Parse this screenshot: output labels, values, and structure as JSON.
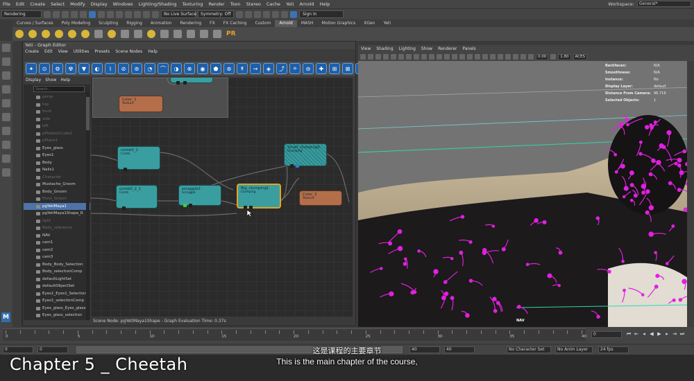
{
  "menubar": {
    "items": [
      "File",
      "Edit",
      "Create",
      "Select",
      "Modify",
      "Display",
      "Windows",
      "Lighting/Shading",
      "Texturing",
      "Render",
      "Toon",
      "Stereo",
      "Cache",
      "Yeti",
      "Arnold",
      "Help"
    ],
    "workspace_label": "Workspace:",
    "workspace_value": "General*"
  },
  "statusline": {
    "menuset": "Rendering",
    "live_surface": "No Live Surface",
    "symmetry": "Symmetry: Off",
    "sign_in": "Sign In"
  },
  "shelf": {
    "tabs": [
      "Curves / Surfaces",
      "Poly Modeling",
      "Sculpting",
      "Rigging",
      "Animation",
      "Rendering",
      "FX",
      "FX Caching",
      "Custom",
      "Arnold",
      "MASH",
      "Motion Graphics",
      "XGen",
      "Yeti"
    ],
    "active_tab": "Arnold"
  },
  "graph_editor": {
    "title": "Yeti - Graph Editor",
    "menu": [
      "Create",
      "Edit",
      "View",
      "Utilities",
      "Presets",
      "Scene Nodes",
      "Help"
    ],
    "status": "Scene Node: pgYetiMaya1Shape - Graph Evaluation Time: 0.37s"
  },
  "outliner": {
    "menu": [
      "Display",
      "Show",
      "Help"
    ],
    "search_placeholder": "Search...",
    "items": [
      {
        "label": "persp",
        "dim": true
      },
      {
        "label": "top",
        "dim": true
      },
      {
        "label": "front",
        "dim": true
      },
      {
        "label": "side",
        "dim": true
      },
      {
        "label": "left",
        "dim": true
      },
      {
        "label": "pPlatonicCube1",
        "dim": true
      },
      {
        "label": "pPlane1",
        "dim": true
      },
      {
        "label": "Eyes_glass",
        "dim": false
      },
      {
        "label": "Eyes1",
        "dim": false
      },
      {
        "label": "Body",
        "dim": false
      },
      {
        "label": "Nails1",
        "dim": false
      },
      {
        "label": "Character",
        "dim": true
      },
      {
        "label": "Mustache_Groom",
        "dim": false
      },
      {
        "label": "Body_Groom",
        "dim": false
      },
      {
        "label": "Front_Groom",
        "dim": true
      },
      {
        "label": "pgYetiMaya1",
        "dim": false,
        "selected": true
      },
      {
        "label": "pgYetiMaya1Shape_R",
        "dim": false
      },
      {
        "label": "light",
        "dim": true
      },
      {
        "label": "Body_reference",
        "dim": true
      },
      {
        "label": "NAV",
        "dim": false
      },
      {
        "label": "cam1",
        "dim": false
      },
      {
        "label": "cam2",
        "dim": false
      },
      {
        "label": "cam3",
        "dim": false
      },
      {
        "label": "Body_Body_Selection",
        "dim": false
      },
      {
        "label": "Body_selectionComp",
        "dim": false
      },
      {
        "label": "defaultLightSet",
        "dim": false
      },
      {
        "label": "defaultObjectSet",
        "dim": false
      },
      {
        "label": "Eyes1_Eyes1_Selection",
        "dim": false
      },
      {
        "label": "Eyes1_selectionComp",
        "dim": false
      },
      {
        "label": "Eyes_glass_Eyes_glass",
        "dim": false
      },
      {
        "label": "Eyes_glass_selection",
        "dim": false
      }
    ]
  },
  "nodes": [
    {
      "id": "color1",
      "title": "Color_1",
      "sub": "Texture",
      "kind": "brown"
    },
    {
      "id": "comb02",
      "title": "comb0_2",
      "sub": "Comb",
      "kind": "teal"
    },
    {
      "id": "comb021",
      "title": "comb0_2_1",
      "sub": "Comb",
      "kind": "teal"
    },
    {
      "id": "scraggle2",
      "title": "scraggle2",
      "sub": "Scraggle",
      "kind": "teal"
    },
    {
      "id": "bigclump",
      "title": "Big_clumping1",
      "sub": "Clumping",
      "kind": "teal"
    },
    {
      "id": "smallclump",
      "title": "Small_clumping0",
      "sub": "Clumping",
      "kind": "teal"
    },
    {
      "id": "color2",
      "title": "Color_2",
      "sub": "Texture",
      "kind": "brown"
    }
  ],
  "viewport": {
    "menu": [
      "View",
      "Shading",
      "Lighting",
      "Show",
      "Renderer",
      "Panels"
    ],
    "value_a": "0.00",
    "value_b": "1.80",
    "aces": "ACES",
    "hud": [
      {
        "k": "Backfaces:",
        "v": "N/A"
      },
      {
        "k": "Smoothness:",
        "v": "N/A"
      },
      {
        "k": "Instance:",
        "v": "No"
      },
      {
        "k": "Display Layer:",
        "v": "default"
      },
      {
        "k": "Distance From Camera:",
        "v": "96.719"
      },
      {
        "k": "Selected Objects:",
        "v": "1"
      }
    ],
    "nav_label": "NAV"
  },
  "timeline": {
    "ticks": [
      "0",
      "5",
      "10",
      "15",
      "20",
      "25",
      "30",
      "35",
      "40"
    ],
    "current_frame": "0"
  },
  "range": {
    "start": "0",
    "start2": "0",
    "end": "40",
    "end2": "40",
    "character_set": "No Character Set",
    "anim_layer": "No Anim Layer",
    "fps": "24 fps"
  },
  "overlay": {
    "chapter": "Chapter 5 _ Cheetah",
    "subtitle_zh": "这是课程的主要章节",
    "subtitle_en": "This is the main chapter of the course,"
  }
}
